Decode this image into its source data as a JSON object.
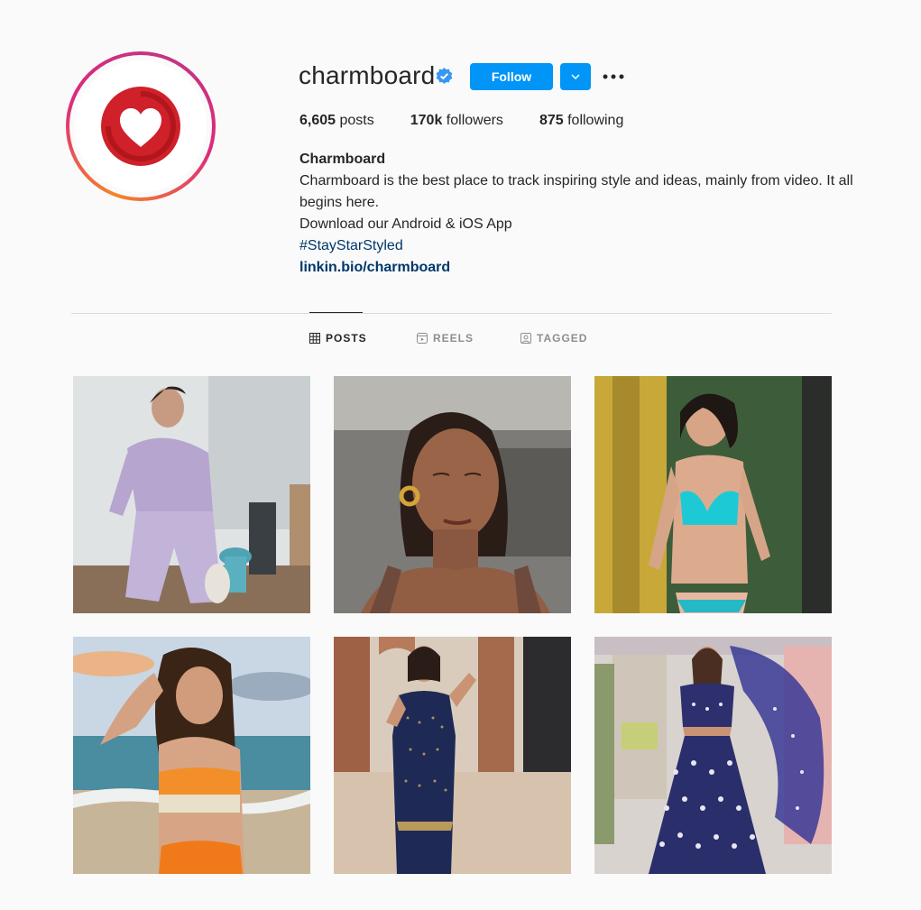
{
  "profile": {
    "username": "charmboard",
    "follow_label": "Follow",
    "posts_count": "6,605",
    "posts_label": "posts",
    "followers_count": "170k",
    "followers_label": "followers",
    "following_count": "875",
    "following_label": "following"
  },
  "bio": {
    "name": "Charmboard",
    "line1": "Charmboard is the best place to track inspiring style and ideas, mainly from video. It all begins here.",
    "line2": "Download our Android & iOS App",
    "hashtag": "#StayStarStyled",
    "link": "linkin.bio/charmboard"
  },
  "tabs": [
    {
      "label": "POSTS",
      "icon": "grid-icon",
      "active": true
    },
    {
      "label": "REELS",
      "icon": "reels-icon",
      "active": false
    },
    {
      "label": "TAGGED",
      "icon": "tagged-icon",
      "active": false
    }
  ],
  "colors": {
    "accent": "#0095f6",
    "link": "#00376b",
    "brand_red": "#d0202a"
  },
  "posts": [
    {
      "description": "woman in lavender tee laughing"
    },
    {
      "description": "woman with gold hoop earrings"
    },
    {
      "description": "woman in turquoise bikini"
    },
    {
      "description": "woman at beach in crochet top"
    },
    {
      "description": "woman in navy kurta"
    },
    {
      "description": "woman in navy lehenga with dupatta"
    }
  ]
}
